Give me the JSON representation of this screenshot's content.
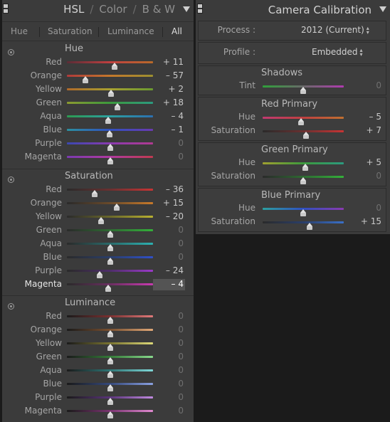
{
  "hsl_panel": {
    "tabs": [
      "HSL",
      "Color",
      "B & W"
    ],
    "active_tab": 0,
    "subtabs": [
      "Hue",
      "Saturation",
      "Luminance",
      "All"
    ],
    "active_subtab": 3,
    "groups": [
      {
        "title": "Hue",
        "rows": [
          {
            "label": "Red",
            "value": "+ 11",
            "num": 11,
            "grad": [
              "#5b2c36",
              "#c04040",
              "#b86a2a"
            ]
          },
          {
            "label": "Orange",
            "value": "– 57",
            "num": -57,
            "grad": [
              "#b03a3a",
              "#c4782c",
              "#9c9030"
            ]
          },
          {
            "label": "Yellow",
            "value": "+ 2",
            "num": 2,
            "grad": [
              "#b06a2a",
              "#a8a030",
              "#6a9a30"
            ]
          },
          {
            "label": "Green",
            "value": "+ 18",
            "num": 18,
            "grad": [
              "#8c9a30",
              "#3c9a3c",
              "#2c9a80"
            ]
          },
          {
            "label": "Aqua",
            "value": "– 4",
            "num": -4,
            "grad": [
              "#2c9a50",
              "#2ca0a0",
              "#2c70b0"
            ]
          },
          {
            "label": "Blue",
            "value": "– 1",
            "num": -1,
            "grad": [
              "#2c90a0",
              "#3050c0",
              "#6a3ab0"
            ]
          },
          {
            "label": "Purple",
            "value": "0",
            "num": 0,
            "grad": [
              "#3a48b0",
              "#8a3ab0",
              "#b03a90"
            ]
          },
          {
            "label": "Magenta",
            "value": "0",
            "num": 0,
            "grad": [
              "#7a3ab0",
              "#b03aa0",
              "#c03a50"
            ]
          }
        ]
      },
      {
        "title": "Saturation",
        "rows": [
          {
            "label": "Red",
            "value": "– 36",
            "num": -36,
            "grad": [
              "#2a2a2a",
              "#6a3030",
              "#c83434"
            ]
          },
          {
            "label": "Orange",
            "value": "+ 15",
            "num": 15,
            "grad": [
              "#2a2a2a",
              "#6a4a2a",
              "#c87a2a"
            ]
          },
          {
            "label": "Yellow",
            "value": "– 20",
            "num": -20,
            "grad": [
              "#2a2a2a",
              "#6a682a",
              "#b8b030"
            ]
          },
          {
            "label": "Green",
            "value": "0",
            "num": 0,
            "grad": [
              "#2a2a2a",
              "#2e6a32",
              "#34b03a"
            ]
          },
          {
            "label": "Aqua",
            "value": "0",
            "num": 0,
            "grad": [
              "#2a2a2a",
              "#2a6a6a",
              "#2cb0b0"
            ]
          },
          {
            "label": "Blue",
            "value": "0",
            "num": 0,
            "grad": [
              "#2a2a2a",
              "#2a3e6a",
              "#3050c8"
            ]
          },
          {
            "label": "Purple",
            "value": "– 24",
            "num": -24,
            "grad": [
              "#2a2a2a",
              "#4e2e6a",
              "#9a3ac8"
            ]
          },
          {
            "label": "Magenta",
            "value": "– 4",
            "num": -4,
            "grad": [
              "#2a2a2a",
              "#6a2e60",
              "#c83ab0"
            ],
            "highlight": true
          }
        ]
      },
      {
        "title": "Luminance",
        "rows": [
          {
            "label": "Red",
            "value": "0",
            "num": 0,
            "grad": [
              "#1a1a1a",
              "#7a3030",
              "#e07a7a"
            ]
          },
          {
            "label": "Orange",
            "value": "0",
            "num": 0,
            "grad": [
              "#1a1a1a",
              "#7a5030",
              "#e0a878"
            ]
          },
          {
            "label": "Yellow",
            "value": "0",
            "num": 0,
            "grad": [
              "#1a1a1a",
              "#7a7430",
              "#dcd878"
            ]
          },
          {
            "label": "Green",
            "value": "0",
            "num": 0,
            "grad": [
              "#1a1a1a",
              "#347a38",
              "#88d88c"
            ]
          },
          {
            "label": "Aqua",
            "value": "0",
            "num": 0,
            "grad": [
              "#1a1a1a",
              "#2e7676",
              "#80d8d8"
            ]
          },
          {
            "label": "Blue",
            "value": "0",
            "num": 0,
            "grad": [
              "#1a1a1a",
              "#34487a",
              "#8aa0e0"
            ]
          },
          {
            "label": "Purple",
            "value": "0",
            "num": 0,
            "grad": [
              "#1a1a1a",
              "#5a347a",
              "#c08ae0"
            ]
          },
          {
            "label": "Magenta",
            "value": "0",
            "num": 0,
            "grad": [
              "#1a1a1a",
              "#7a3470",
              "#e08ad0"
            ]
          }
        ]
      }
    ]
  },
  "calibration_panel": {
    "title": "Camera Calibration",
    "process_label": "Process :",
    "process_value": "2012 (Current)",
    "profile_label": "Profile :",
    "profile_value": "Embedded",
    "sections": [
      {
        "title": "Shadows",
        "rows": [
          {
            "label": "Tint",
            "value": "0",
            "num": 0,
            "grad": [
              "#2fa03a",
              "#6a6a6a",
              "#b03ab0"
            ]
          }
        ]
      },
      {
        "title": "Red Primary",
        "rows": [
          {
            "label": "Hue",
            "value": "– 5",
            "num": -5,
            "grad": [
              "#c03a70",
              "#c04040",
              "#c07030"
            ]
          },
          {
            "label": "Saturation",
            "value": "+ 7",
            "num": 7,
            "grad": [
              "#2a2a2a",
              "#6a3030",
              "#c83434"
            ]
          }
        ]
      },
      {
        "title": "Green Primary",
        "rows": [
          {
            "label": "Hue",
            "value": "+ 5",
            "num": 5,
            "grad": [
              "#a0a030",
              "#3c9a3c",
              "#2c9a80"
            ]
          },
          {
            "label": "Saturation",
            "value": "0",
            "num": 0,
            "grad": [
              "#2a2a2a",
              "#2e6a32",
              "#34b03a"
            ]
          }
        ]
      },
      {
        "title": "Blue Primary",
        "rows": [
          {
            "label": "Hue",
            "value": "0",
            "num": 0,
            "grad": [
              "#2ca0a0",
              "#3050c0",
              "#8a3ab0"
            ]
          },
          {
            "label": "Saturation",
            "value": "+ 15",
            "num": 15,
            "grad": [
              "#2a2a2a",
              "#2a3e6a",
              "#3a70c8"
            ]
          }
        ]
      }
    ]
  }
}
